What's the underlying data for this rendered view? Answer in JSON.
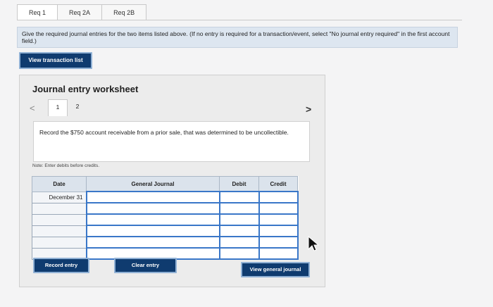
{
  "tabs": [
    {
      "label": "Req 1",
      "active": true
    },
    {
      "label": "Req 2A",
      "active": false
    },
    {
      "label": "Req 2B",
      "active": false
    }
  ],
  "instructions": "Give the required journal entries for the two items listed above. (If no entry is required for a transaction/event, select \"No journal entry required\" in the first account field.)",
  "buttons": {
    "view_transaction_list": "View transaction list",
    "record_entry": "Record entry",
    "clear_entry": "Clear entry",
    "view_general_journal": "View general journal"
  },
  "worksheet": {
    "title": "Journal entry worksheet",
    "pages": [
      "1",
      "2"
    ],
    "active_page": "1",
    "description": "Record the $750 account receivable from a prior sale, that was determined to be uncollectible.",
    "note": "Note: Enter debits before credits."
  },
  "table": {
    "headers": {
      "date": "Date",
      "account": "General Journal",
      "debit": "Debit",
      "credit": "Credit"
    },
    "rows": [
      {
        "date": "December 31",
        "account": "",
        "debit": "",
        "credit": ""
      },
      {
        "date": "",
        "account": "",
        "debit": "",
        "credit": ""
      },
      {
        "date": "",
        "account": "",
        "debit": "",
        "credit": ""
      },
      {
        "date": "",
        "account": "",
        "debit": "",
        "credit": ""
      },
      {
        "date": "",
        "account": "",
        "debit": "",
        "credit": ""
      },
      {
        "date": "",
        "account": "",
        "debit": "",
        "credit": ""
      }
    ]
  },
  "icons": {
    "prev": "chevron-left-icon",
    "next": "chevron-right-icon",
    "cursor": "mouse-pointer-icon"
  },
  "colors": {
    "button_bg": "#0f3b6f",
    "header_bg": "#dbe3ec",
    "instruction_bg": "#dde6f0"
  }
}
